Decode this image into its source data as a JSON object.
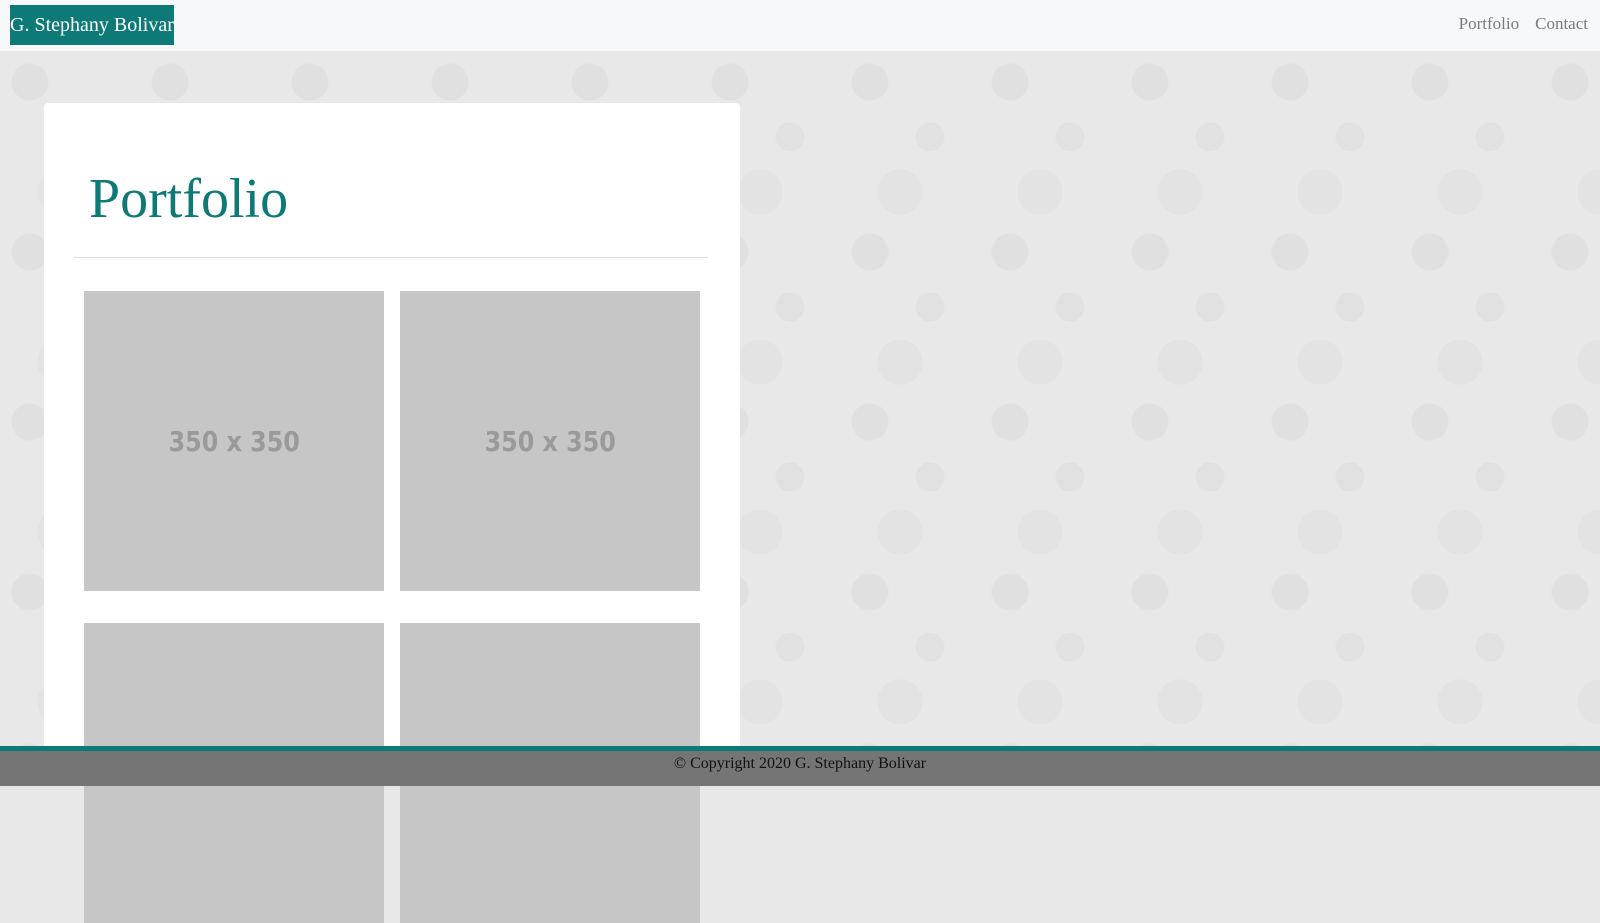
{
  "navbar": {
    "brand": "G. Stephany Bolivar",
    "links": [
      "Portfolio",
      "Contact"
    ]
  },
  "main": {
    "title": "Portfolio",
    "thumbnails": [
      {
        "label": "350 x 350"
      },
      {
        "label": "350 x 350"
      },
      {
        "label": ""
      },
      {
        "label": ""
      }
    ]
  },
  "footer": {
    "text": "© Copyright 2020 G. Stephany Bolivar"
  },
  "colors": {
    "accent": "#0e7a78",
    "navbar_bg": "#f7f8f9",
    "footer_bg": "#757575",
    "placeholder_bg": "#c6c6c6"
  }
}
